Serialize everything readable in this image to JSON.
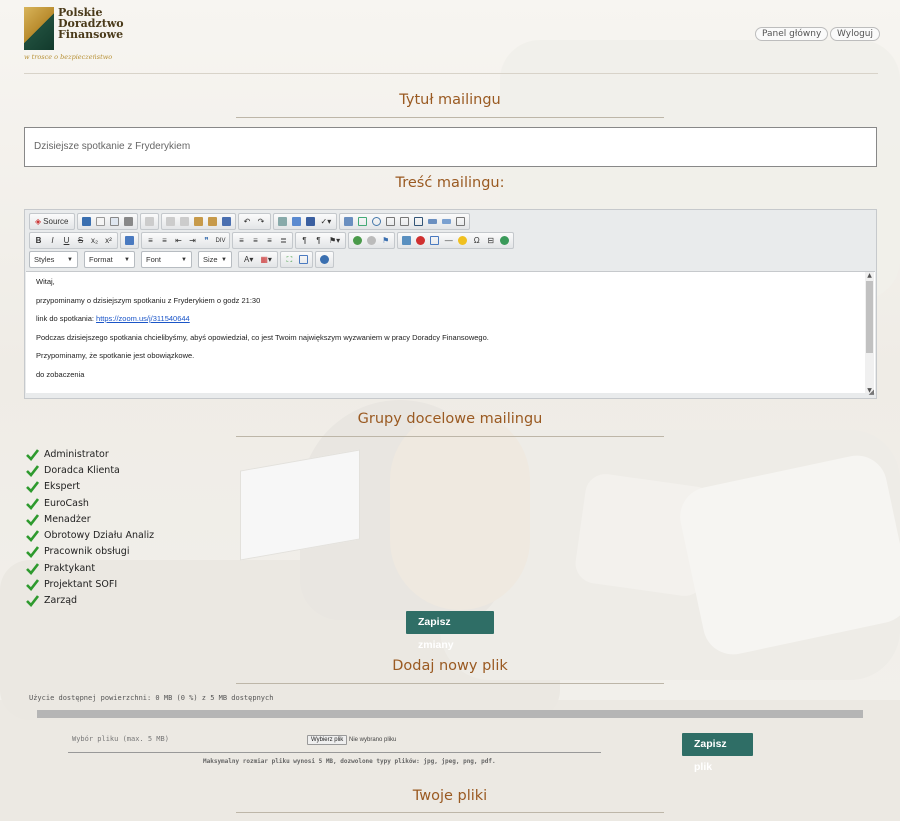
{
  "header": {
    "logo_line1": "Polskie",
    "logo_line2": "Doradztwo",
    "logo_line3": "Finansowe",
    "logo_tagline": "w trosce o bezpieczeństwo",
    "panel_button": "Panel główny",
    "logout_button": "Wyloguj"
  },
  "mailing_title": {
    "heading": "Tytuł mailingu",
    "value": "Dzisiejsze spotkanie z Fryderykiem"
  },
  "mailing_body": {
    "heading": "Treść mailingu:",
    "toolbar": {
      "source_label": "Source",
      "styles": "Styles",
      "format": "Format",
      "font": "Font",
      "size": "Size"
    },
    "lines": [
      "Witaj,",
      "przypominamy o dzisiejszym spotkaniu z Fryderykiem o godz 21:30",
      "link do spotkania: ",
      "Podczas dzisiejszego spotkania chcielibyśmy, abyś opowiedział, co jest Twoim największym wyzwaniem w pracy Doradcy Finansowego.",
      "Przypominamy, że spotkanie jest obowiązkowe.",
      "do zobaczenia"
    ],
    "link": "https://zoom.us/j/311540644"
  },
  "groups": {
    "heading": "Grupy docelowe mailingu",
    "items": [
      {
        "label": "Administrator",
        "checked": true
      },
      {
        "label": "Doradca Klienta",
        "checked": true
      },
      {
        "label": "Ekspert",
        "checked": true
      },
      {
        "label": "EuroCash",
        "checked": true
      },
      {
        "label": "Menadżer",
        "checked": true
      },
      {
        "label": "Obrotowy Działu Analiz",
        "checked": true
      },
      {
        "label": "Pracownik obsługi",
        "checked": true
      },
      {
        "label": "Praktykant",
        "checked": true
      },
      {
        "label": "Projektant SOFI",
        "checked": true
      },
      {
        "label": "Zarząd",
        "checked": true
      }
    ],
    "save_button": "Zapisz zmiany"
  },
  "upload": {
    "heading": "Dodaj nowy plik",
    "usage_text": "Użycie dostępnej powierzchni: 0 MB (0 %) z 5 MB dostępnych",
    "usage_fraction": 0.0,
    "file_label": "Wybór pliku (max. 5 MB)",
    "choose_button": "Wybierz plik",
    "no_file": "Nie wybrano pliku",
    "hint": "Maksymalny rozmiar pliku wynosi 5 MB, dozwolone typy plików: jpg, jpeg, png, pdf.",
    "upload_button": "Zapisz plik"
  },
  "files": {
    "heading": "Twoje pliki"
  },
  "colors": {
    "accent_heading": "#9a5a22",
    "button_green": "#2f6e66",
    "checkmark_green": "#2e9a2e"
  }
}
